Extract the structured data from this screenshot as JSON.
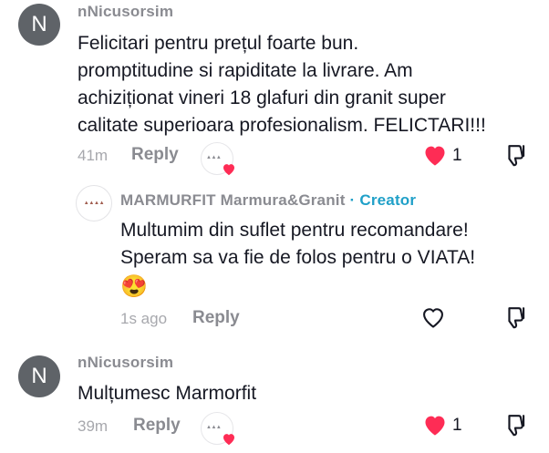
{
  "comments": [
    {
      "avatar_letter": "N",
      "username": "nNicusorsim",
      "lines": [
        "Felicitari pentru prețul foarte bun.",
        "promptitudine si rapiditate la livrare. Am",
        "achiziționat vineri 18 glafuri din granit super",
        "calitate superioara profesionalism. FELICTARI!!!"
      ],
      "time": "41m",
      "reply_label": "Reply",
      "like_count": "1"
    },
    {
      "username": "MARMURFIT Marmura&Granit",
      "separator": "·",
      "creator_label": "Creator",
      "lines": [
        "Multumim din suflet pentru recomandare!",
        "Speram sa va fie de folos pentru o VIATA!"
      ],
      "emoji": "😍",
      "time": "1s ago",
      "reply_label": "Reply"
    },
    {
      "avatar_letter": "N",
      "username": "nNicusorsim",
      "lines": [
        "Mulțumesc Marmorfit"
      ],
      "time": "39m",
      "reply_label": "Reply",
      "like_count": "1"
    }
  ],
  "colors": {
    "like_red": "#fe2c55",
    "creator_blue": "#20a0c8",
    "avatar_gray": "#5f6368"
  },
  "icons": [
    "heart-filled-icon",
    "heart-outline-icon",
    "dislike-icon",
    "creator-liked-badge"
  ]
}
